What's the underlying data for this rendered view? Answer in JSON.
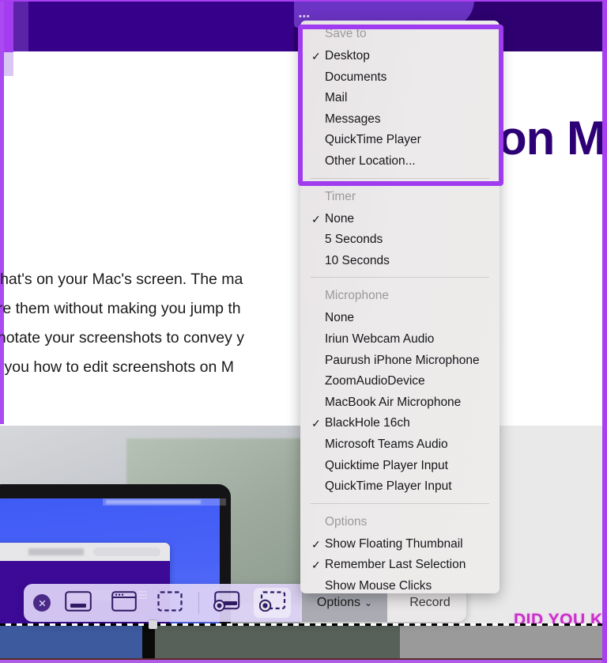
{
  "page": {
    "hero_heading_fragment": "on M",
    "article_lines": [
      "what's on your Mac's screen. The ma",
      "are them without making you jump th",
      "nnotate your screenshots to convey y",
      "w you how to edit screenshots on M"
    ],
    "did_you_know": "DID YOU KN"
  },
  "capture_bar": {
    "close_icon": "close-icon",
    "buttons": [
      {
        "name": "capture-entire-screen",
        "icon": "entire-screen-icon",
        "selected": false
      },
      {
        "name": "capture-selected-window",
        "icon": "selected-window-icon",
        "selected": false
      },
      {
        "name": "capture-selected-portion",
        "icon": "selected-portion-icon",
        "selected": false
      },
      {
        "name": "record-entire-screen",
        "icon": "record-screen-icon",
        "selected": false
      },
      {
        "name": "record-selected-portion",
        "icon": "record-portion-icon",
        "selected": true
      }
    ],
    "options_label": "Options",
    "options_chevron": "⌄",
    "record_label": "Record"
  },
  "menu": {
    "sections": [
      {
        "title": "Save to",
        "items": [
          {
            "label": "Desktop",
            "checked": true
          },
          {
            "label": "Documents",
            "checked": false
          },
          {
            "label": "Mail",
            "checked": false
          },
          {
            "label": "Messages",
            "checked": false
          },
          {
            "label": "QuickTime Player",
            "checked": false
          },
          {
            "label": "Other Location...",
            "checked": false
          }
        ]
      },
      {
        "title": "Timer",
        "items": [
          {
            "label": "None",
            "checked": true
          },
          {
            "label": "5 Seconds",
            "checked": false
          },
          {
            "label": "10 Seconds",
            "checked": false
          }
        ]
      },
      {
        "title": "Microphone",
        "items": [
          {
            "label": "None",
            "checked": false
          },
          {
            "label": "Iriun Webcam Audio",
            "checked": false
          },
          {
            "label": "Paurush iPhone  Microphone",
            "checked": false
          },
          {
            "label": "ZoomAudioDevice",
            "checked": false
          },
          {
            "label": "MacBook Air Microphone",
            "checked": false
          },
          {
            "label": "BlackHole 16ch",
            "checked": true
          },
          {
            "label": "Microsoft Teams Audio",
            "checked": false
          },
          {
            "label": "Quicktime Player Input",
            "checked": false
          },
          {
            "label": "QuickTime Player Input",
            "checked": false
          }
        ]
      },
      {
        "title": "Options",
        "items": [
          {
            "label": "Show Floating Thumbnail",
            "checked": true
          },
          {
            "label": "Remember Last Selection",
            "checked": true
          },
          {
            "label": "Show Mouse Clicks",
            "checked": false
          }
        ]
      }
    ]
  },
  "annotation": {
    "highlight_color": "#a03cf0"
  },
  "colors": {
    "brand_purple": "#a83ff0",
    "hero_dark_purple": "#2e0070",
    "heading_purple": "#2d0175",
    "magenta": "#c830c8",
    "menu_bg": "#eceaea"
  }
}
